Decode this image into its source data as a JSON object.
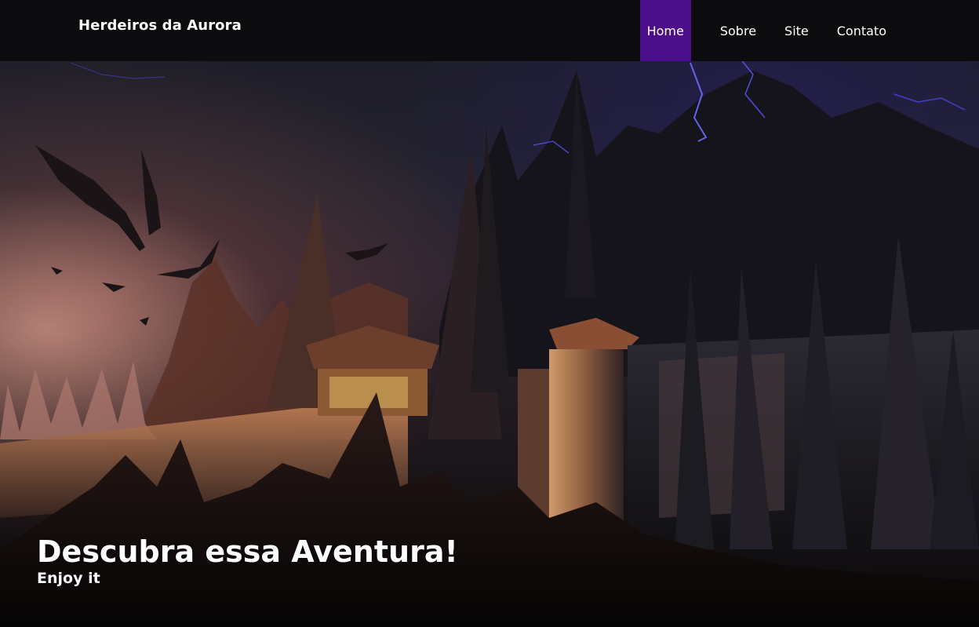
{
  "header": {
    "brand": "Herdeiros da Aurora"
  },
  "nav": {
    "items": [
      {
        "label": "Home",
        "active": true
      },
      {
        "label": "Sobre",
        "active": false
      },
      {
        "label": "Site",
        "active": false
      },
      {
        "label": "Contato",
        "active": false
      }
    ]
  },
  "hero": {
    "title": "Descubra essa Aventura!",
    "subtitle": "Enjoy it"
  },
  "colors": {
    "navbar_bg": "#0c0c0e",
    "active_nav_bg": "#4b0f8c",
    "text": "#ffffff"
  }
}
